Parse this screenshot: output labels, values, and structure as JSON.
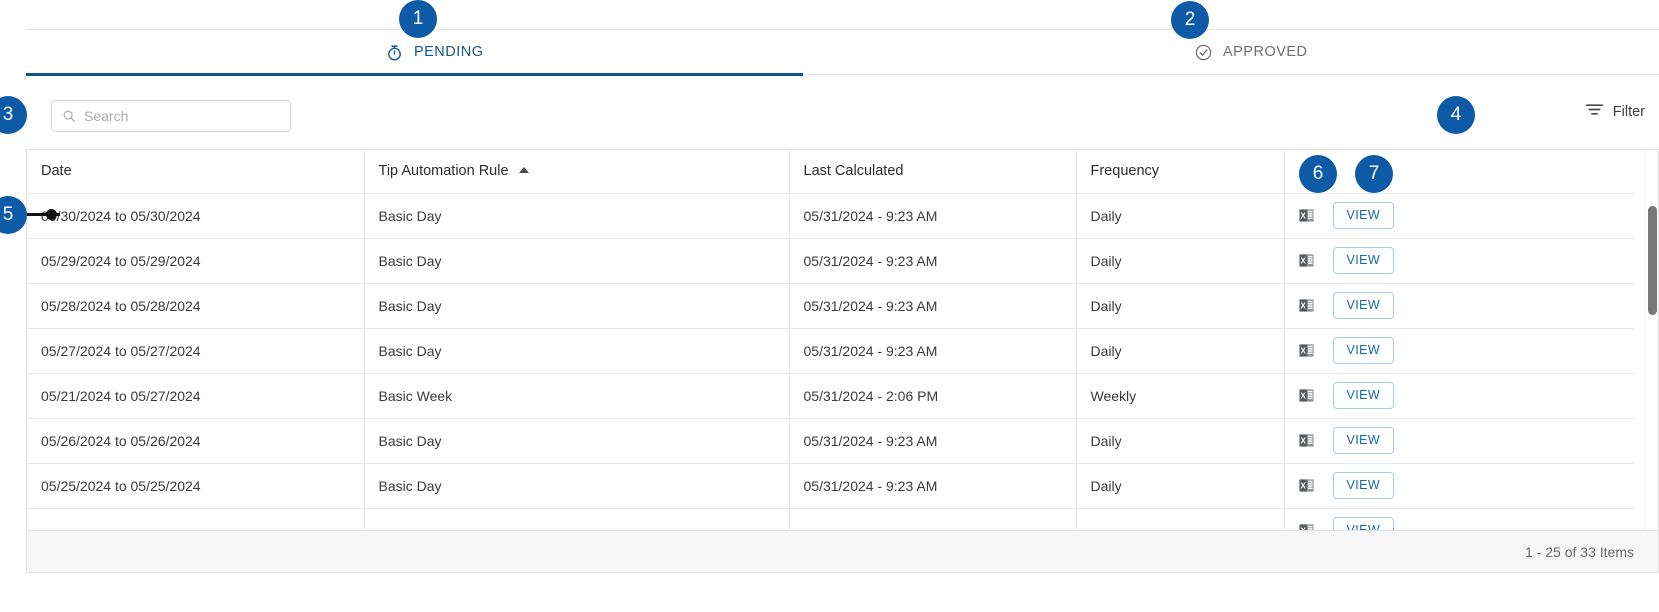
{
  "tabs": [
    {
      "label": "PENDING",
      "icon": "stopwatch-icon",
      "active": true,
      "badge": "1"
    },
    {
      "label": "APPROVED",
      "icon": "check-circle-icon",
      "active": false,
      "badge": "2"
    }
  ],
  "toolbar": {
    "search_placeholder": "Search",
    "search_value": "",
    "search_icon": "search-icon",
    "filter_label": "Filter",
    "filter_icon": "filter-icon"
  },
  "table": {
    "columns": [
      {
        "key": "date",
        "label": "Date",
        "sorted": false
      },
      {
        "key": "rule",
        "label": "Tip Automation Rule",
        "sorted": true,
        "sort_dir": "asc"
      },
      {
        "key": "calc",
        "label": "Last Calculated",
        "sorted": false
      },
      {
        "key": "freq",
        "label": "Frequency",
        "sorted": false
      },
      {
        "key": "actions",
        "label": "",
        "sorted": false
      }
    ],
    "rows": [
      {
        "date": "05/30/2024 to 05/30/2024",
        "rule": "Basic Day",
        "calc": "05/31/2024 - 9:23 AM",
        "freq": "Daily",
        "export_icon": "excel-icon",
        "view_label": "VIEW"
      },
      {
        "date": "05/29/2024 to 05/29/2024",
        "rule": "Basic Day",
        "calc": "05/31/2024 - 9:23 AM",
        "freq": "Daily",
        "export_icon": "excel-icon",
        "view_label": "VIEW"
      },
      {
        "date": "05/28/2024 to 05/28/2024",
        "rule": "Basic Day",
        "calc": "05/31/2024 - 9:23 AM",
        "freq": "Daily",
        "export_icon": "excel-icon",
        "view_label": "VIEW"
      },
      {
        "date": "05/27/2024 to 05/27/2024",
        "rule": "Basic Day",
        "calc": "05/31/2024 - 9:23 AM",
        "freq": "Daily",
        "export_icon": "excel-icon",
        "view_label": "VIEW"
      },
      {
        "date": "05/21/2024 to 05/27/2024",
        "rule": "Basic Week",
        "calc": "05/31/2024 - 2:06 PM",
        "freq": "Weekly",
        "export_icon": "excel-icon",
        "view_label": "VIEW"
      },
      {
        "date": "05/26/2024 to 05/26/2024",
        "rule": "Basic Day",
        "calc": "05/31/2024 - 9:23 AM",
        "freq": "Daily",
        "export_icon": "excel-icon",
        "view_label": "VIEW"
      },
      {
        "date": "05/25/2024 to 05/25/2024",
        "rule": "Basic Day",
        "calc": "05/31/2024 - 9:23 AM",
        "freq": "Daily",
        "export_icon": "excel-icon",
        "view_label": "VIEW"
      },
      {
        "date": "",
        "rule": "",
        "calc": "",
        "freq": "",
        "export_icon": "excel-icon",
        "view_label": "VIEW"
      }
    ]
  },
  "footer": {
    "count_label": "1 - 25 of 33 Items"
  },
  "callouts": [
    {
      "number": "1",
      "target": "pending-tab"
    },
    {
      "number": "2",
      "target": "approved-tab"
    },
    {
      "number": "3",
      "target": "search-input"
    },
    {
      "number": "4",
      "target": "filter-button"
    },
    {
      "number": "5",
      "target": "first-row-date"
    },
    {
      "number": "6",
      "target": "excel-export-icon"
    },
    {
      "number": "7",
      "target": "view-button"
    }
  ],
  "colors": {
    "accent": "#13558c",
    "badge": "#0d5ba6",
    "link": "#1668a8",
    "border": "#e4e4e4",
    "footer_bg": "#f7f7f7"
  }
}
